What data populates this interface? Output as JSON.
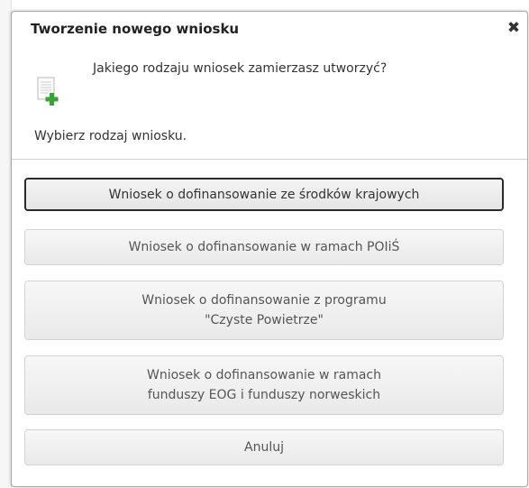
{
  "dialog": {
    "title": "Tworzenie nowego wniosku",
    "close_symbol": "✖",
    "icon": "new-document-plus-icon",
    "question": "Jakiego rodzaju wniosek zamierzasz utworzyć?",
    "instruction": "Wybierz rodzaj wniosku."
  },
  "buttons": {
    "krajowe": "Wniosek o dofinansowanie ze środków krajowych",
    "poiis": "Wniosek o dofinansowanie w ramach POIiŚ",
    "czyste_line1": "Wniosek o dofinansowanie z programu",
    "czyste_line2": "\"Czyste Powietrze\"",
    "eog_line1": "Wniosek o dofinansowanie w ramach",
    "eog_line2": "funduszy EOG i funduszy norweskich",
    "cancel": "Anuluj"
  },
  "colors": {
    "plus_green": "#3aa335",
    "button_border": "#d3d3d3",
    "focused_border": "#2a2a2a"
  }
}
